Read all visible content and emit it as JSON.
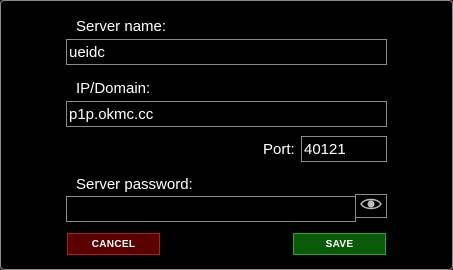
{
  "dialog": {
    "server_name_label": "Server name:",
    "server_name_value": "ueidc",
    "domain_label": "IP/Domain:",
    "domain_value": "p1p.okmc.cc",
    "port_label": "Port:",
    "port_value": "40121",
    "password_label": "Server password:",
    "password_value": "",
    "cancel_label": "CANCEL",
    "save_label": "SAVE"
  },
  "icons": {
    "password_toggle": "eye-icon"
  },
  "colors": {
    "cancel_bg": "#5a0000",
    "save_bg": "#0a5a0a",
    "field_border": "#8c8c8c"
  }
}
